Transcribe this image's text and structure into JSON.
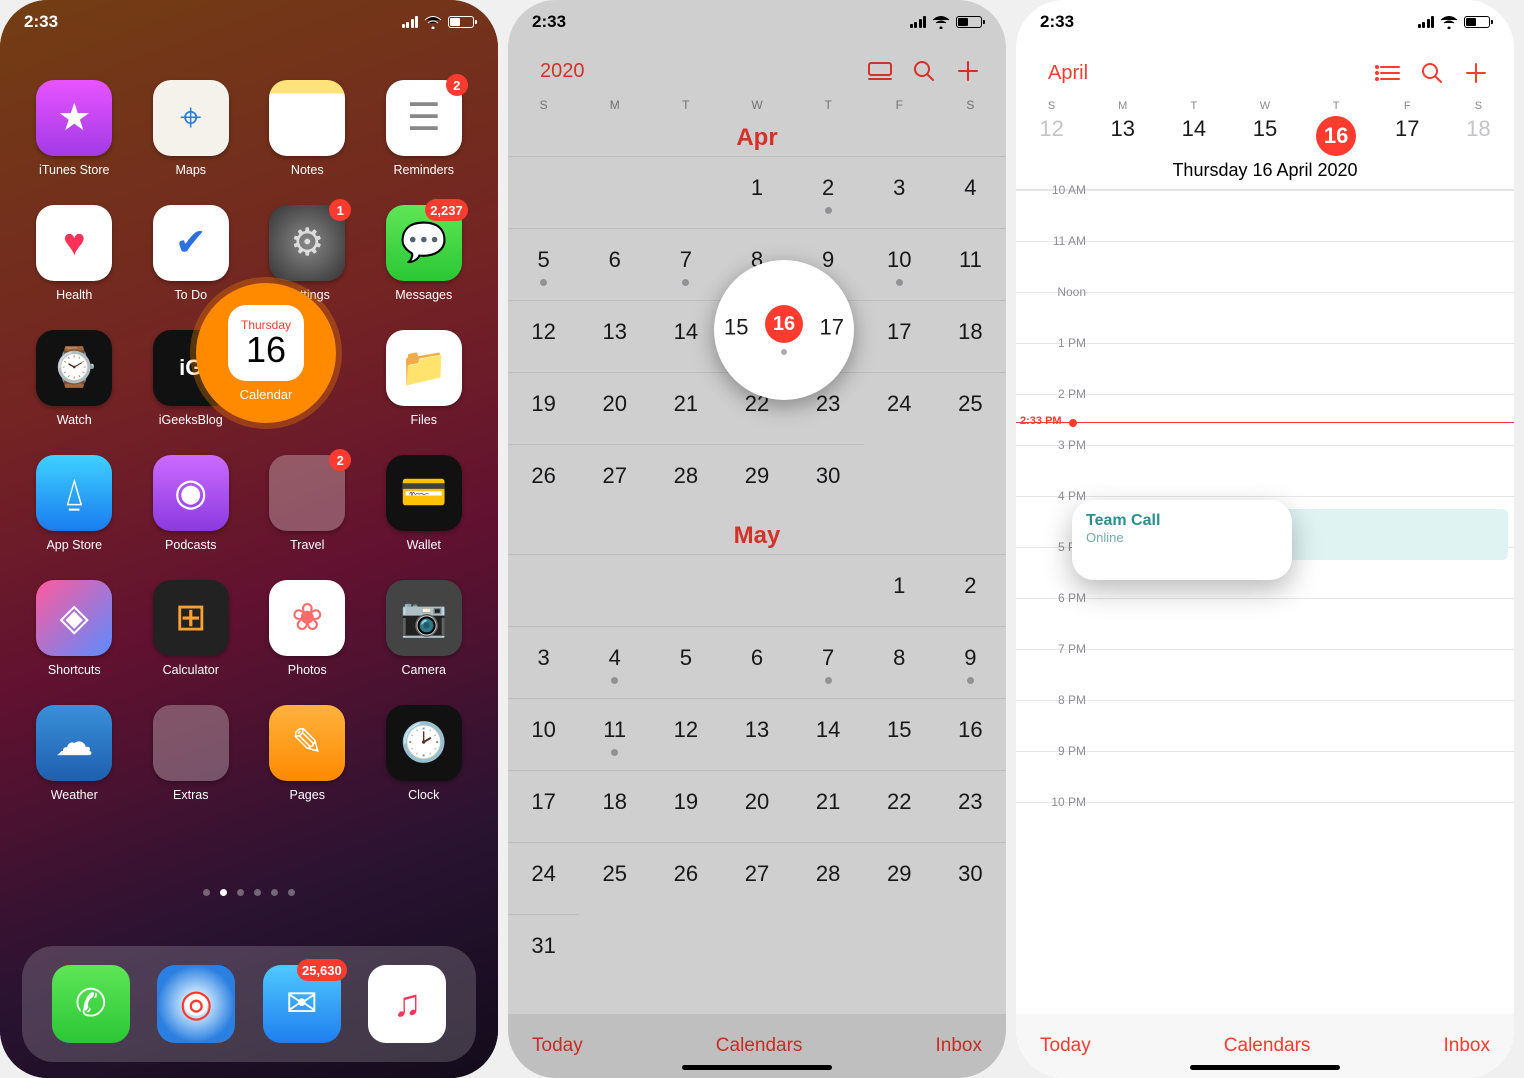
{
  "status": {
    "time": "2:33"
  },
  "home": {
    "highlight": {
      "day_of_week": "Thursday",
      "day_num": "16",
      "label": "Calendar"
    },
    "apps": [
      {
        "name": "iTunes Store",
        "color": "linear-gradient(180deg,#e754ff,#a23be6)",
        "glyph": "★",
        "gcolor": "#fff"
      },
      {
        "name": "Maps",
        "color": "#f5f2ec",
        "glyph": "⌖",
        "gcolor": "#2b7cd3"
      },
      {
        "name": "Notes",
        "color": "linear-gradient(180deg,#ffe27a 18%,#fff 18%)",
        "glyph": "",
        "gcolor": "#888"
      },
      {
        "name": "Reminders",
        "color": "#fff",
        "glyph": "☰",
        "gcolor": "#888",
        "badge": "2"
      },
      {
        "name": "Health",
        "color": "#fff",
        "glyph": "♥",
        "gcolor": "#ff3258"
      },
      {
        "name": "To Do",
        "color": "#fff",
        "glyph": "✔",
        "gcolor": "#2b6fe0"
      },
      {
        "name": "Settings",
        "color": "radial-gradient(circle,#888,#333)",
        "glyph": "⚙",
        "gcolor": "#ddd",
        "badge": "1"
      },
      {
        "name": "Messages",
        "color": "linear-gradient(180deg,#5ee657,#2bc735)",
        "glyph": "💬",
        "gcolor": "#fff",
        "badge": "2,237"
      },
      {
        "name": "Watch",
        "color": "#111",
        "glyph": "⌚",
        "gcolor": "#ddd"
      },
      {
        "name": "iGeeksBlog",
        "color": "#111",
        "glyph": "iG",
        "gcolor": "#fff",
        "textglyph": true
      },
      {
        "name": "Calendar",
        "spacer": true
      },
      {
        "name": "Files",
        "color": "#fff",
        "glyph": "📁",
        "gcolor": "#2d8cff"
      },
      {
        "name": "App Store",
        "color": "linear-gradient(180deg,#3fd0ff,#1a7cf0)",
        "glyph": "⍙",
        "gcolor": "#fff"
      },
      {
        "name": "Podcasts",
        "color": "linear-gradient(180deg,#cc6bff,#8a3ae0)",
        "glyph": "◉",
        "gcolor": "#fff"
      },
      {
        "name": "Travel",
        "folder": true,
        "badge": "2",
        "folderColors": [
          "#ffa030",
          "#ff5a3c",
          "#ffc633",
          "#36c15e",
          "#2f90ff",
          "#2bc7d9",
          "#ff3b30",
          "#f7b500",
          "#8e8e93"
        ]
      },
      {
        "name": "Wallet",
        "color": "#111",
        "glyph": "💳",
        "gcolor": "#fff"
      },
      {
        "name": "Shortcuts",
        "color": "linear-gradient(135deg,#ff5a9e,#5a8cff)",
        "glyph": "◈",
        "gcolor": "#fff"
      },
      {
        "name": "Calculator",
        "color": "#222",
        "glyph": "⊞",
        "gcolor": "#ffa030"
      },
      {
        "name": "Photos",
        "color": "#fff",
        "glyph": "❀",
        "gcolor": "#ff6b6b"
      },
      {
        "name": "Camera",
        "color": "#444",
        "glyph": "📷",
        "gcolor": "#ddd"
      },
      {
        "name": "Weather",
        "color": "linear-gradient(180deg,#3a90d9,#1f5fb0)",
        "glyph": "☁",
        "gcolor": "#fff"
      },
      {
        "name": "Extras",
        "folder": true,
        "folderColors": [
          "#ff5a3c",
          "#ffc633",
          "#36c15e",
          "#ff3b30",
          "#2f90ff",
          "#2bc7d9",
          "#8e8e93",
          "#f7b500",
          "#ffa030"
        ]
      },
      {
        "name": "Pages",
        "color": "linear-gradient(180deg,#ffb23e,#ff8a00)",
        "glyph": "✎",
        "gcolor": "#fff"
      },
      {
        "name": "Clock",
        "color": "#111",
        "glyph": "🕑",
        "gcolor": "#fff"
      }
    ],
    "dock": [
      {
        "name": "Phone",
        "color": "linear-gradient(180deg,#5ee657,#2bc735)",
        "glyph": "✆",
        "gcolor": "#fff"
      },
      {
        "name": "Safari",
        "color": "radial-gradient(circle,#fff 20%,#c4e4ff 22%,#2b7fe0 70%)",
        "glyph": "◎",
        "gcolor": "#ff3b30"
      },
      {
        "name": "Mail",
        "color": "linear-gradient(180deg,#4fc9ff,#1f7ef0)",
        "glyph": "✉",
        "gcolor": "#fff",
        "badge": "25,630"
      },
      {
        "name": "Music",
        "color": "#fff",
        "glyph": "♫",
        "gcolor": "#ff3258"
      }
    ],
    "page_dots": {
      "count": 6,
      "active": 1
    }
  },
  "yearview": {
    "back_label": "2020",
    "weekday_short": [
      "S",
      "M",
      "T",
      "W",
      "T",
      "F",
      "S"
    ],
    "month1": {
      "name": "Apr",
      "leading_blanks": 3,
      "days": 30,
      "event_days": [
        2,
        5,
        7,
        9,
        10,
        16
      ],
      "today": 16
    },
    "month2": {
      "name": "May",
      "leading_blanks": 5,
      "days": 31,
      "event_days": [
        4,
        7,
        9,
        11
      ]
    },
    "toolbar": {
      "today": "Today",
      "calendars": "Calendars",
      "inbox": "Inbox"
    },
    "highlight": {
      "left_ghost": "15",
      "center": "16",
      "right_ghost": "17"
    }
  },
  "dayview": {
    "back_label": "April",
    "weekday_short": [
      "S",
      "M",
      "T",
      "W",
      "T",
      "F",
      "S"
    ],
    "dates": [
      "12",
      "13",
      "14",
      "15",
      "16",
      "17",
      "18"
    ],
    "today_index": 4,
    "title": "Thursday  16 April 2020",
    "hours": [
      "10 AM",
      "11 AM",
      "Noon",
      "1 PM",
      "2 PM",
      "3 PM",
      "4 PM",
      "5 PM",
      "6 PM",
      "7 PM",
      "8 PM",
      "9 PM",
      "10 PM"
    ],
    "now_label": "2:33 PM",
    "now_position_hours": 4.55,
    "event": {
      "title": "Team Call",
      "sub": "Online",
      "start_hours": 6.25,
      "end_hours": 7.25
    },
    "toolbar": {
      "today": "Today",
      "calendars": "Calendars",
      "inbox": "Inbox"
    }
  }
}
